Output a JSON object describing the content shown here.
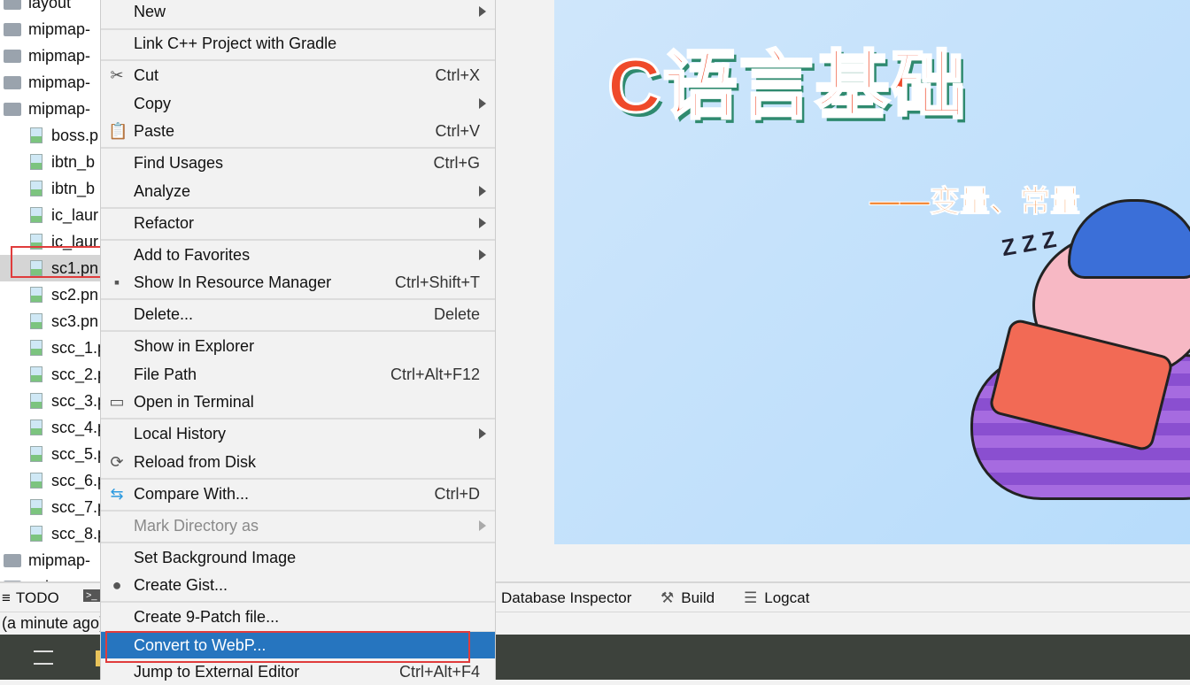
{
  "tree": {
    "items": [
      {
        "label": "layout",
        "type": "folder"
      },
      {
        "label": "mipmap-",
        "type": "folder"
      },
      {
        "label": "mipmap-",
        "type": "folder"
      },
      {
        "label": "mipmap-",
        "type": "folder"
      },
      {
        "label": "mipmap-",
        "type": "folder"
      },
      {
        "label": "boss.p",
        "type": "file"
      },
      {
        "label": "ibtn_b",
        "type": "file"
      },
      {
        "label": "ibtn_b",
        "type": "file"
      },
      {
        "label": "ic_laur",
        "type": "file"
      },
      {
        "label": "ic_laur",
        "type": "file"
      },
      {
        "label": "sc1.pn",
        "type": "file",
        "selected": true
      },
      {
        "label": "sc2.pn",
        "type": "file"
      },
      {
        "label": "sc3.pn",
        "type": "file"
      },
      {
        "label": "scc_1.p",
        "type": "file"
      },
      {
        "label": "scc_2.p",
        "type": "file"
      },
      {
        "label": "scc_3.p",
        "type": "file"
      },
      {
        "label": "scc_4.p",
        "type": "file"
      },
      {
        "label": "scc_5.p",
        "type": "file"
      },
      {
        "label": "scc_6.p",
        "type": "file"
      },
      {
        "label": "scc_7.p",
        "type": "file"
      },
      {
        "label": "scc_8.p",
        "type": "file"
      },
      {
        "label": "mipmap-",
        "type": "folder"
      },
      {
        "label": "values",
        "type": "folder"
      }
    ]
  },
  "preview": {
    "title": "C语言基础",
    "subtitle": "——变量、常量",
    "zzz": "Z Z Z"
  },
  "menu": {
    "items": [
      {
        "label": "New",
        "submenu": true
      },
      {
        "label": "Link C++ Project with Gradle"
      },
      {
        "label": "Cut",
        "shortcut": "Ctrl+X",
        "icon": "scissors-icon"
      },
      {
        "label": "Copy",
        "submenu": true
      },
      {
        "label": "Paste",
        "shortcut": "Ctrl+V",
        "icon": "clipboard-icon"
      },
      {
        "label": "Find Usages",
        "shortcut": "Ctrl+G"
      },
      {
        "label": "Analyze",
        "submenu": true
      },
      {
        "label": "Refactor",
        "submenu": true
      },
      {
        "label": "Add to Favorites",
        "submenu": true
      },
      {
        "label": "Show In Resource Manager",
        "shortcut": "Ctrl+Shift+T",
        "icon": "resource-manager-icon"
      },
      {
        "label": "Delete...",
        "shortcut": "Delete"
      },
      {
        "label": "Show in Explorer"
      },
      {
        "label": "File Path",
        "shortcut": "Ctrl+Alt+F12"
      },
      {
        "label": "Open in Terminal",
        "icon": "terminal-icon"
      },
      {
        "label": "Local History",
        "submenu": true
      },
      {
        "label": "Reload from Disk",
        "icon": "reload-icon"
      },
      {
        "label": "Compare With...",
        "shortcut": "Ctrl+D",
        "icon": "compare-icon"
      },
      {
        "label": "Mark Directory as",
        "submenu": true,
        "disabled": true
      },
      {
        "label": "Set Background Image"
      },
      {
        "label": "Create Gist...",
        "icon": "github-icon"
      },
      {
        "label": "Create 9-Patch file..."
      },
      {
        "label": "Convert to WebP...",
        "highlighted": true
      },
      {
        "label": "Jump to External Editor",
        "shortcut": "Ctrl+Alt+F4"
      }
    ]
  },
  "toolbar": {
    "todo": "TODO",
    "database_inspector": "Database Inspector",
    "build": "Build",
    "logcat": "Logcat"
  },
  "status": {
    "text": "(a minute ago)"
  },
  "colors": {
    "highlight": "#2675bf",
    "annotation": "#e03c3c",
    "taskbar": "#3d423c"
  }
}
